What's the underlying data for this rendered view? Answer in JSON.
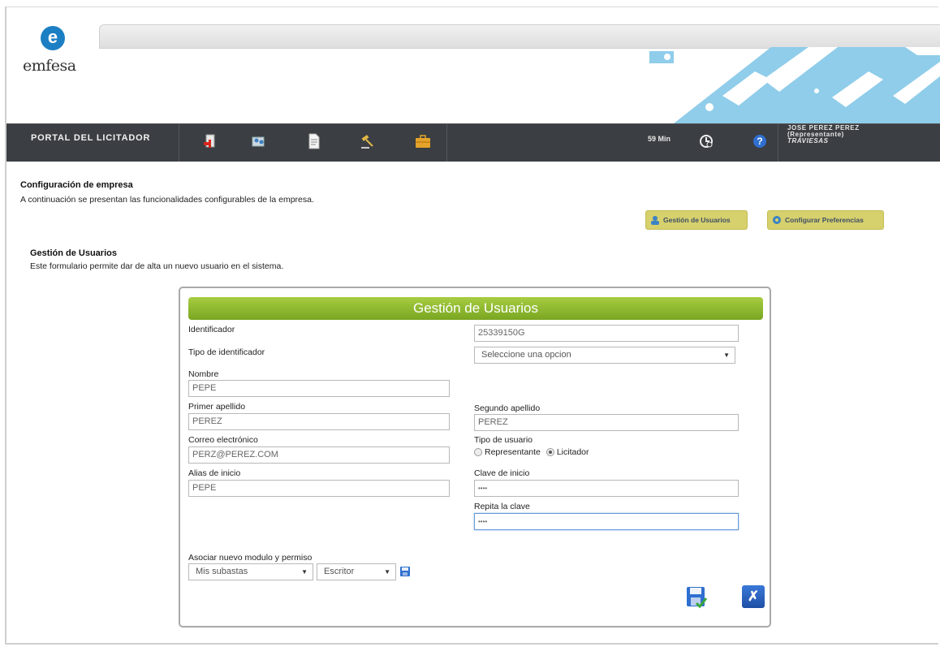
{
  "brand": {
    "logo_letter": "e",
    "logo_text": "emfesa"
  },
  "nav": {
    "title": "PORTAL DEL LICITADOR",
    "icons": [
      "exit-icon",
      "users-icon",
      "document-icon",
      "auction-icon",
      "briefcase-icon"
    ],
    "timer": "59 Min",
    "user_name": "JOSE PEREZ PEREZ",
    "user_role": "(Representante)",
    "user_company": "TRAVIESAS"
  },
  "config": {
    "title": "Configuración de empresa",
    "description": "A continuación se presentan las funcionalidades configurables de la empresa.",
    "btn_users": "Gestión de Usuarios",
    "btn_prefs": "Configurar Preferencias"
  },
  "users_section": {
    "title": "Gestión de Usuarios",
    "description": "Este formulario permite dar de alta un nuevo usuario en el sistema."
  },
  "form": {
    "header": "Gestión de Usuarios",
    "identificador_label": "Identificador",
    "identificador_value": "25339150G",
    "tipo_id_label": "Tipo de identificador",
    "tipo_id_value": "Seleccione una opcion",
    "nombre_label": "Nombre",
    "nombre_value": "PEPE",
    "apellido1_label": "Primer apellido",
    "apellido1_value": "PEREZ",
    "apellido2_label": "Segundo apellido",
    "apellido2_value": "PEREZ",
    "email_label": "Correo electrónico",
    "email_value": "PERZ@PEREZ.COM",
    "tipo_usuario_label": "Tipo de usuario",
    "tipo_usuario_options": [
      "Representante",
      "Licitador"
    ],
    "tipo_usuario_selected": "Licitador",
    "alias_label": "Alias de inicio",
    "alias_value": "PEPE",
    "clave_label": "Clave de inicio",
    "clave_value": "••••",
    "repita_label": "Repita la clave",
    "repita_value": "••••",
    "asociar_label": "Asociar nuevo modulo y permiso",
    "modulo_value": "Mis subastas",
    "permiso_value": "Escritor"
  },
  "colors": {
    "nav_bg": "#3b3e42",
    "header_green": "#8fbb30",
    "button_green": "#d6d06d",
    "banner_blue": "#8fcdea"
  }
}
